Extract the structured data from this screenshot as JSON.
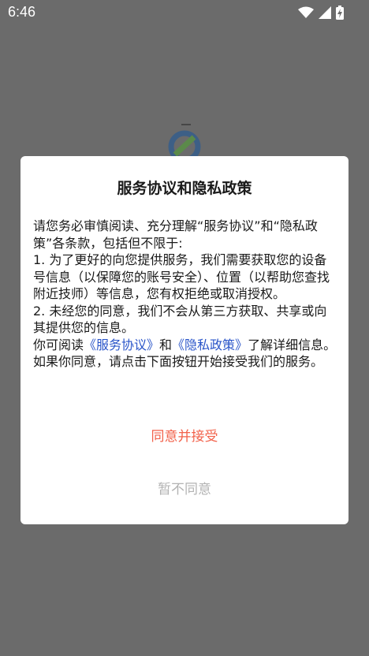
{
  "status_bar": {
    "time": "6:46",
    "icons": [
      "wifi-icon",
      "signal-icon",
      "battery-charging-icon"
    ]
  },
  "dialog": {
    "title": "服务协议和隐私政策",
    "intro": "请您务必审慎阅读、充分理解“服务协议”和“隐私政策”各条款，包括但不限于:",
    "item1": "1. 为了更好的向您提供服务，我们需要获取您的设备号信息（以保障您的账号安全）、位置（以帮助您查找附近技师）等信息，您有权拒绝或取消授权。",
    "item2": "2. 未经您的同意，我们不会从第三方获取、共享或向其提供您的信息。",
    "read_prefix": "你可阅读",
    "service_link": "《服务协议》",
    "and_text": "和",
    "privacy_link": "《隐私政策》",
    "read_suffix": "了解详细信息。如果你同意，请点击下面按钮开始接受我们的服务。",
    "accept_label": "同意并接受",
    "decline_label": "暂不同意"
  },
  "colors": {
    "accent": "#f2614a",
    "link": "#2a55c9",
    "overlay": "#6b6b6b"
  }
}
